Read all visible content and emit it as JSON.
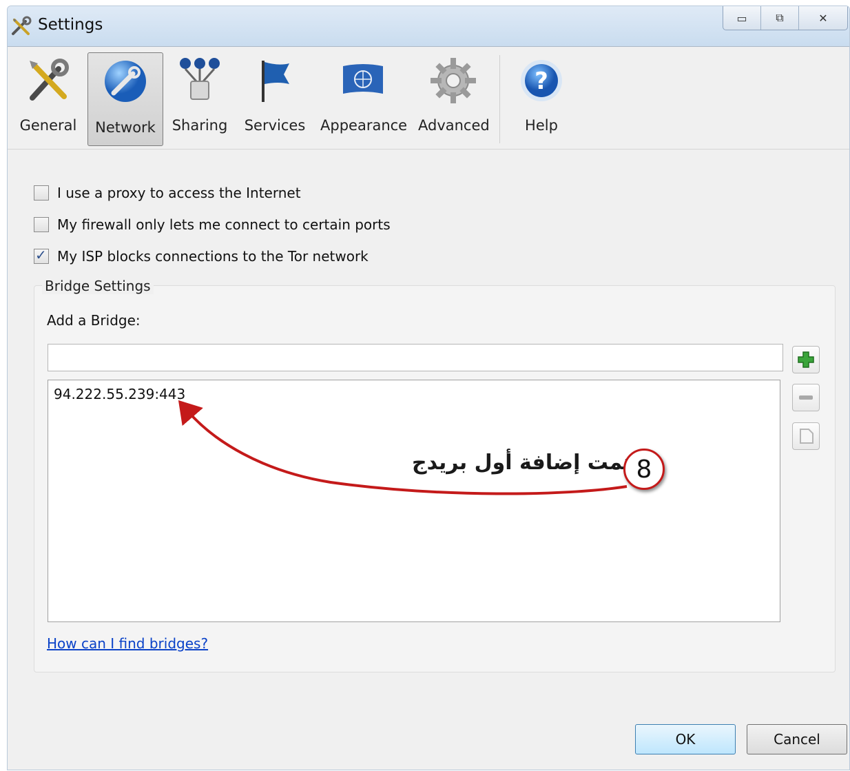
{
  "window": {
    "title": "Settings"
  },
  "titlebar_buttons": {
    "minimize": "▭",
    "restore": "⧉",
    "close": "✕"
  },
  "toolbar": {
    "items": [
      {
        "label": "General",
        "icon": "tools-icon"
      },
      {
        "label": "Network",
        "icon": "globe-wrench-icon"
      },
      {
        "label": "Sharing",
        "icon": "network-share-icon"
      },
      {
        "label": "Services",
        "icon": "flag-icon"
      },
      {
        "label": "Appearance",
        "icon": "un-flag-icon"
      },
      {
        "label": "Advanced",
        "icon": "gear-icon"
      },
      {
        "label": "Help",
        "icon": "help-icon"
      }
    ],
    "selected": "Network"
  },
  "network": {
    "proxy_label": "I use a proxy to access the Internet",
    "proxy_checked": false,
    "firewall_label": "My firewall only lets me connect to certain ports",
    "firewall_checked": false,
    "isp_label": "My ISP blocks connections to the Tor network",
    "isp_checked": true
  },
  "bridge": {
    "group_title": "Bridge Settings",
    "add_label": "Add a Bridge:",
    "input_value": "",
    "items": [
      "94.222.55.239:443"
    ],
    "help_link": "How can I find bridges?"
  },
  "annotation": {
    "number": "8",
    "text": "تمت إضافة أول بريدج",
    "color": "#c41a1a"
  },
  "buttons": {
    "ok": "OK",
    "cancel": "Cancel"
  }
}
